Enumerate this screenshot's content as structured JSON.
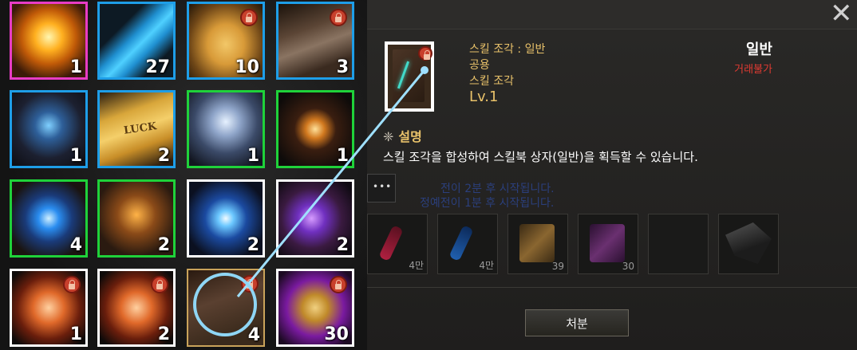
{
  "inventory": {
    "slots": [
      {
        "count": "1",
        "icon": "glowing-spellbook-icon",
        "lock": false
      },
      {
        "count": "27",
        "icon": "blue-feather-icon",
        "lock": false
      },
      {
        "count": "10",
        "icon": "scroll-ticket-icon",
        "lock": true
      },
      {
        "count": "3",
        "icon": "closed-book-icon",
        "lock": true
      },
      {
        "count": "1",
        "icon": "blue-spellbook-icon",
        "lock": false
      },
      {
        "count": "2",
        "icon": "luck-ticket-icon",
        "lock": false,
        "label": "LUCK"
      },
      {
        "count": "1",
        "icon": "ornate-chest-icon",
        "lock": false
      },
      {
        "count": "1",
        "icon": "star-emblem-icon",
        "lock": false
      },
      {
        "count": "4",
        "icon": "blue-orb-icon",
        "lock": false
      },
      {
        "count": "2",
        "icon": "orange-spellbook-icon",
        "lock": false
      },
      {
        "count": "2",
        "icon": "blue-star-icon",
        "lock": false
      },
      {
        "count": "2",
        "icon": "purple-orb-icon",
        "lock": false
      },
      {
        "count": "1",
        "icon": "orange-crystal-icon",
        "lock": true
      },
      {
        "count": "2",
        "icon": "orange-crystal-icon",
        "lock": true
      },
      {
        "count": "4",
        "icon": "skill-fragment-icon",
        "lock": true
      },
      {
        "count": "30",
        "icon": "purple-scroll-icon",
        "lock": true
      }
    ]
  },
  "tooltip": {
    "category": "스킬 조각 : 일반",
    "usage": "공용",
    "type": "스킬 조각",
    "level": "Lv.1",
    "grade": "일반",
    "trade_status": "거래불가",
    "desc_title": "설명",
    "desc_symbol": "❈",
    "description": "스킬 조각을 합성하여 스킬북 상자(일반)을 획득할 수 있습니다.",
    "ghost_line_1": "전이 2분 후 시작됩니다.",
    "ghost_line_2": "정예전이 1분 후 시작됩니다.",
    "mini_counts": [
      "4만",
      "4만",
      "39",
      "30"
    ],
    "button_label": "처분",
    "close_symbol": "✕"
  },
  "colors": {
    "rare_border": "#e83cc4",
    "blue_border": "#1e9ee8",
    "green_border": "#1fd23a",
    "white_border": "#ffffff",
    "gold_text": "#e9c26a",
    "red_text": "#e03a32"
  }
}
